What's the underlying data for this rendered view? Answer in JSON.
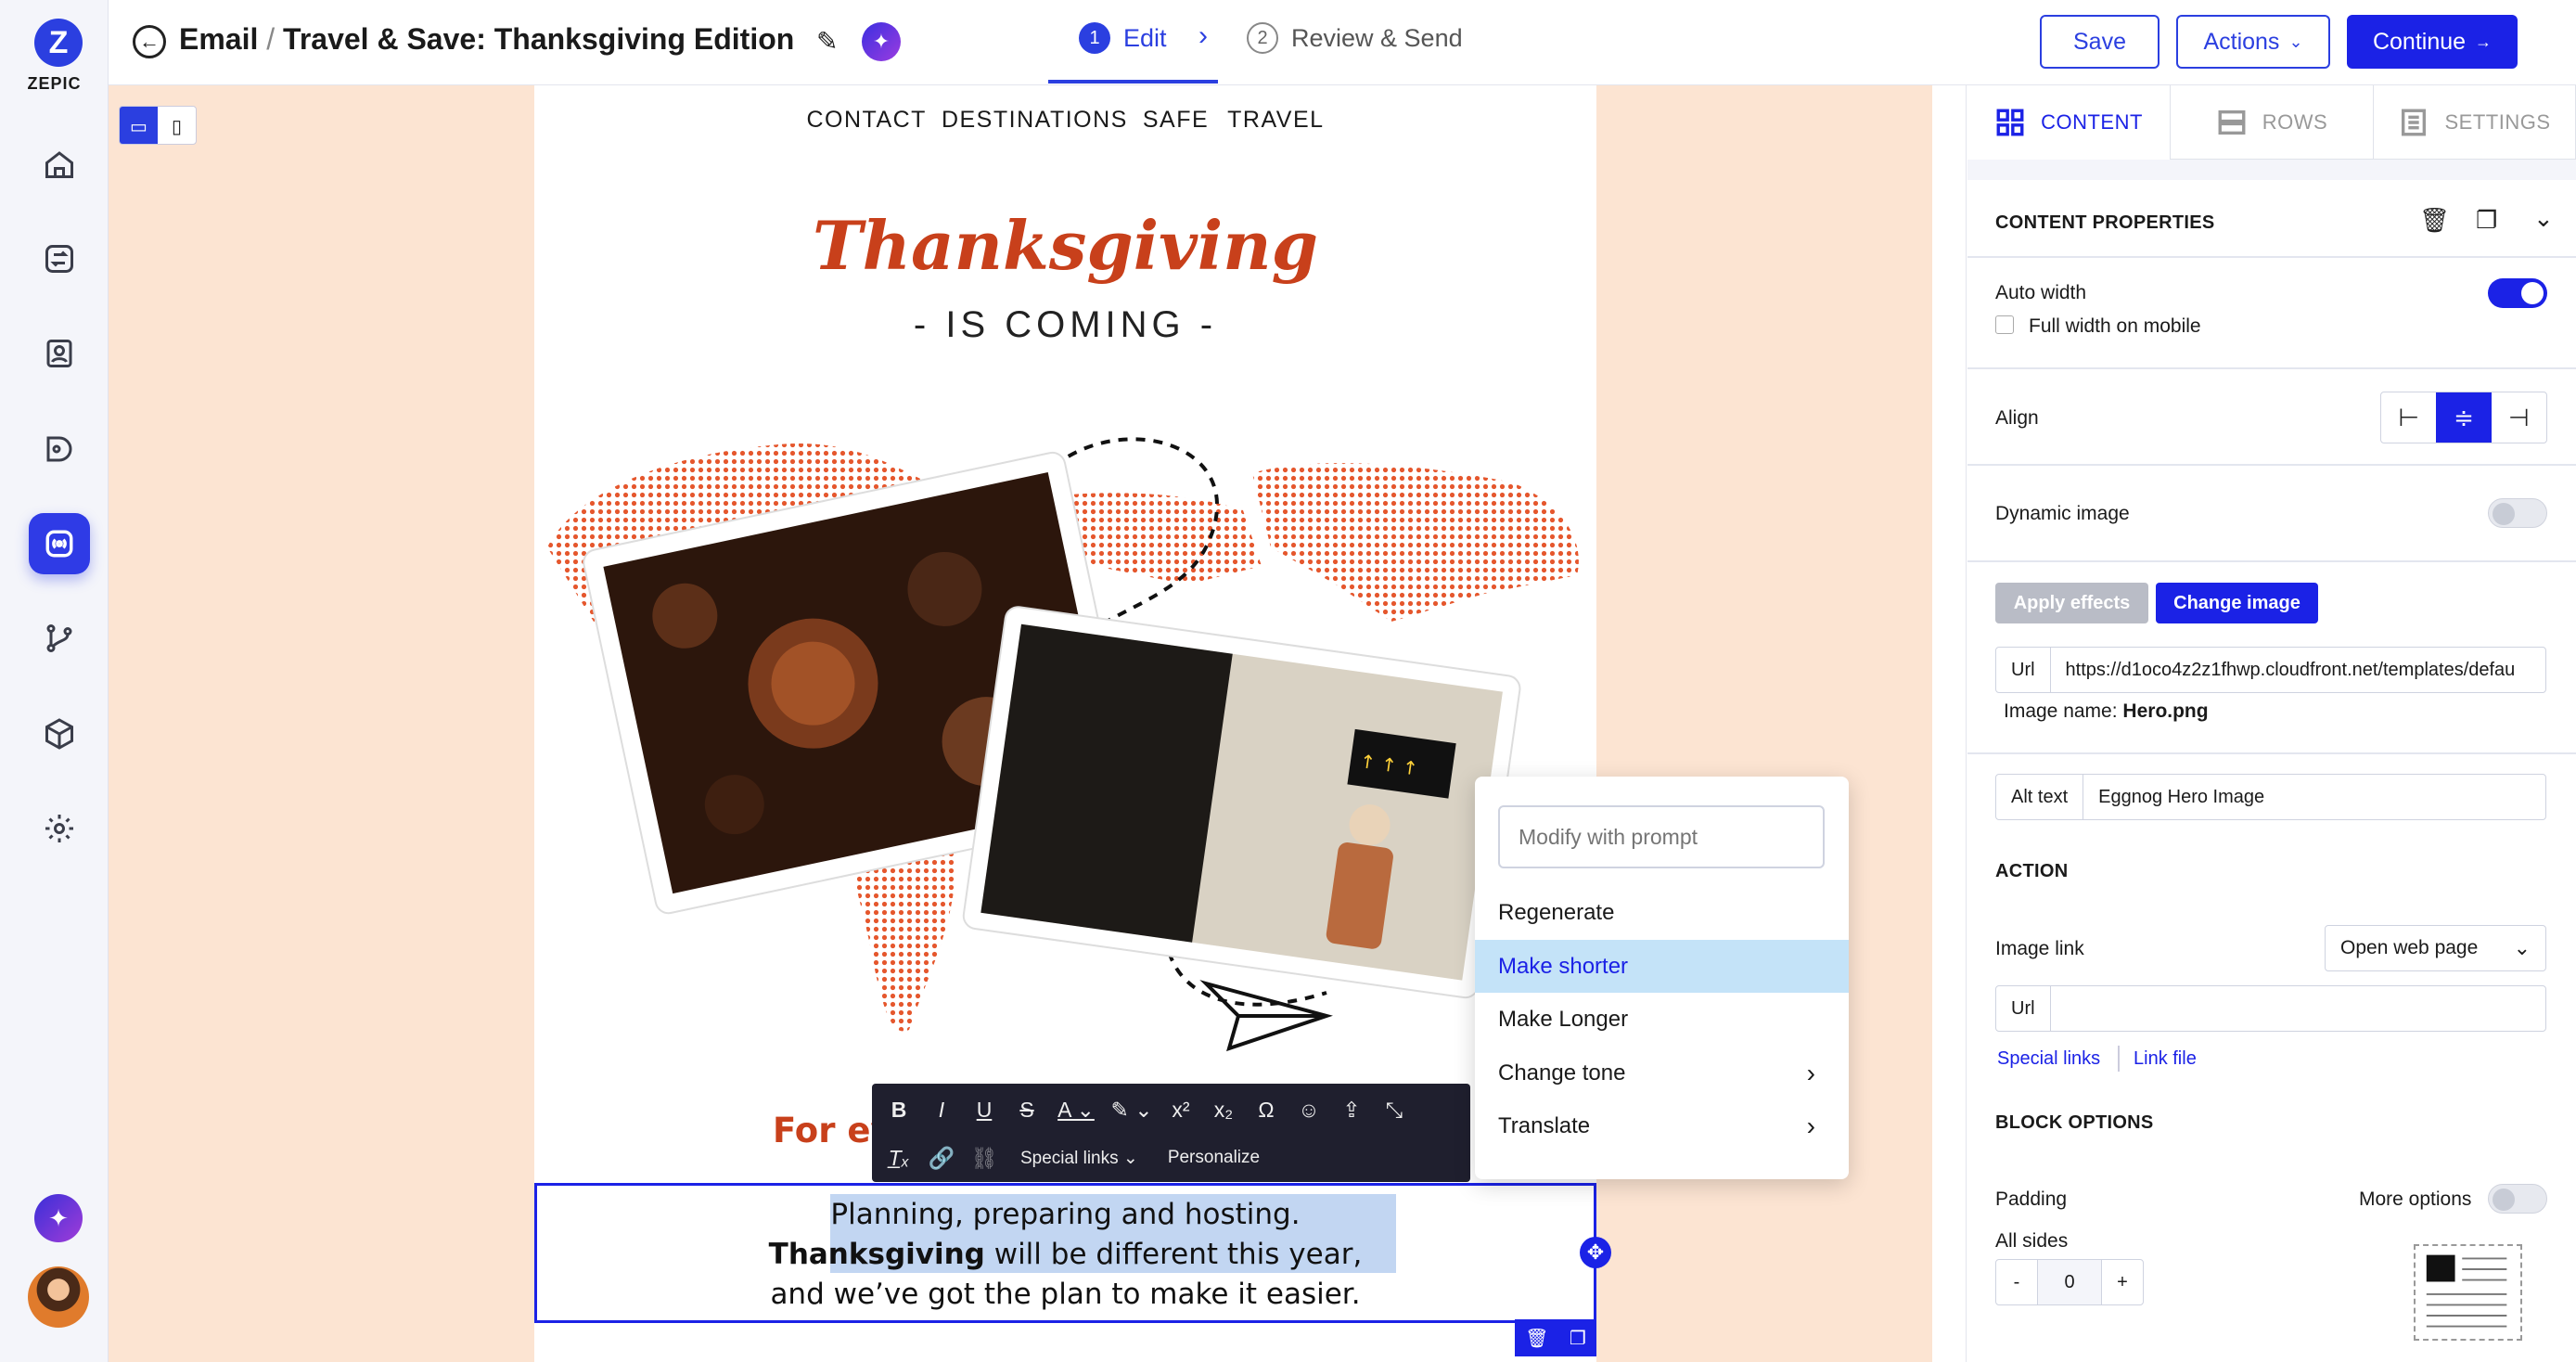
{
  "brand": {
    "name": "ZEPIC",
    "logo_letter": "Z"
  },
  "nav": {
    "items": [
      "home-icon",
      "swap-icon",
      "contacts-icon",
      "segments-icon",
      "broadcast-icon",
      "flows-icon",
      "cube-icon",
      "gear-icon"
    ],
    "active": "broadcast-icon"
  },
  "header": {
    "section": "Email",
    "separator": "/",
    "title": "Travel & Save: Thanksgiving Edition"
  },
  "steps": [
    {
      "num": "1",
      "label": "Edit",
      "active": true
    },
    {
      "num": "2",
      "label": "Review & Send",
      "active": false
    }
  ],
  "buttons": {
    "save": "Save",
    "actions": "Actions",
    "continue": "Continue"
  },
  "email": {
    "nav_links": [
      "CONTACT",
      "DESTINATIONS",
      "SAFE TRAVEL"
    ],
    "headline": "Thanksgiving",
    "subheadline": "- IS COMING -",
    "partial_heading": "For ev",
    "para_line1": "Planning, preparing and hosting.",
    "para_bold": "Thanksgiving",
    "para_line2_rest": " will be different this year,",
    "para_line3": "and we’ve got the plan to make it easier."
  },
  "toolbar": {
    "special_links": "Special links",
    "personalize": "Personalize"
  },
  "ai_menu": {
    "prompt_placeholder": "Modify with prompt",
    "items": [
      {
        "label": "Regenerate",
        "submenu": false,
        "selected": false
      },
      {
        "label": "Make shorter",
        "submenu": false,
        "selected": true
      },
      {
        "label": "Make Longer",
        "submenu": false,
        "selected": false
      },
      {
        "label": "Change tone",
        "submenu": true,
        "selected": false
      },
      {
        "label": "Translate",
        "submenu": true,
        "selected": false
      }
    ]
  },
  "panel": {
    "tabs": [
      {
        "label": "CONTENT",
        "active": true
      },
      {
        "label": "ROWS",
        "active": false
      },
      {
        "label": "SETTINGS",
        "active": false
      }
    ],
    "content_properties": "CONTENT PROPERTIES",
    "auto_width": "Auto width",
    "full_width_mobile": "Full width on mobile",
    "align": "Align",
    "dynamic_image": "Dynamic image",
    "apply_effects": "Apply effects",
    "change_image": "Change image",
    "url_label": "Url",
    "url_value": "https://d1oco4z2z1fhwp.cloudfront.net/templates/defau",
    "image_name_label": "Image name:",
    "image_name": "Hero.png",
    "alt_label": "Alt text",
    "alt_value": "Eggnog Hero Image",
    "action_header": "ACTION",
    "image_link": "Image link",
    "image_link_value": "Open web page",
    "link_url_label": "Url",
    "special_links": "Special links",
    "link_file": "Link file",
    "block_options": "BLOCK OPTIONS",
    "padding": "Padding",
    "more_options": "More options",
    "all_sides": "All sides",
    "padding_minus": "-",
    "padding_value": "0",
    "padding_plus": "+"
  },
  "colors": {
    "accent": "#1b22e6",
    "brand_orange": "#c8401b",
    "canvas_bg": "#fce4d2",
    "selection": "#c2d6f2",
    "menu_highlight": "#c4e3f8"
  }
}
